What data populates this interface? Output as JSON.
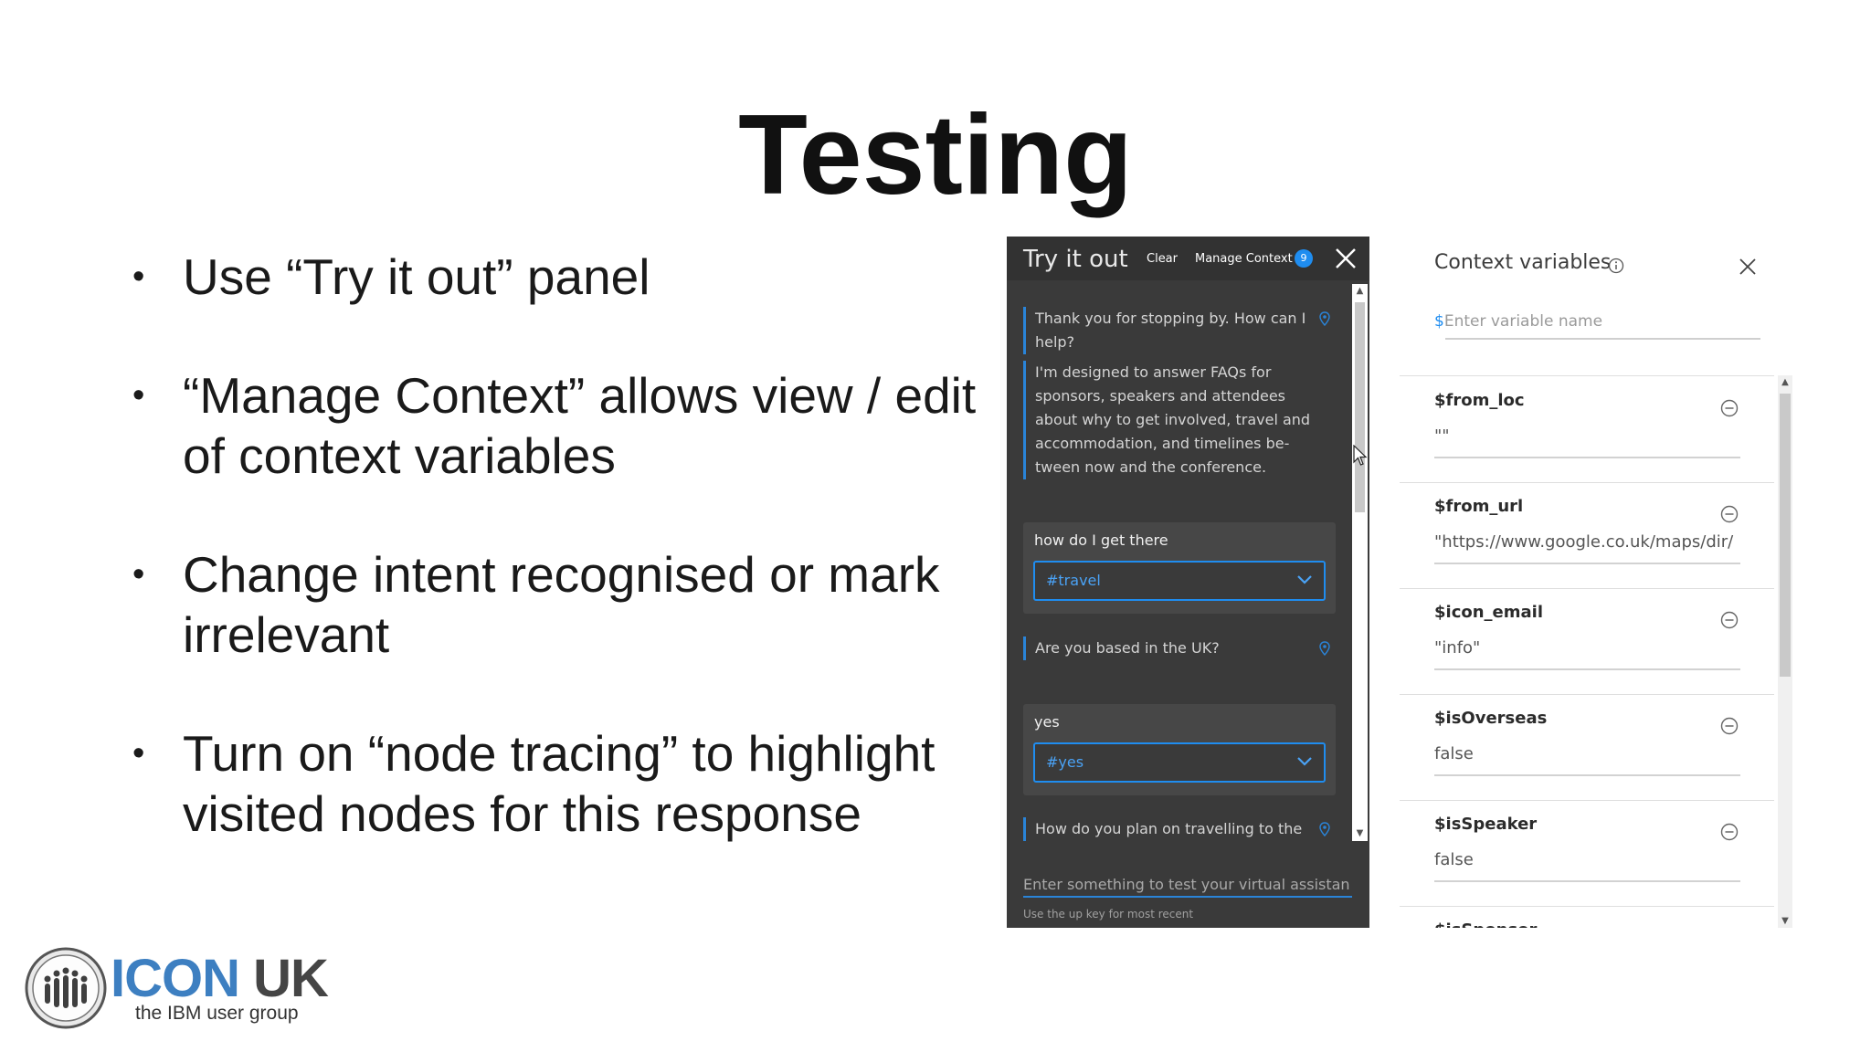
{
  "slide": {
    "title": "Testing",
    "bullets": [
      {
        "line1": "Use “Try it out” panel",
        "line2": ""
      },
      {
        "line1": "“Manage Context” allows view / edit",
        "line2": "of context variables"
      },
      {
        "line1": "Change intent recognised or mark",
        "line2": "irrelevant"
      },
      {
        "line1": "Turn on “node tracing” to highlight",
        "line2": "visited nodes for this response"
      }
    ],
    "bullet_char": "•"
  },
  "try_it_out": {
    "title": "Try it out",
    "clear_label": "Clear",
    "manage_context_label": "Manage Context",
    "context_count": "9",
    "messages": [
      "Thank you for stopping by. How can I help?",
      "I'm designed to answer FAQs for sponsors, speakers and attendees about why to get involved, travel and accommodation, and timelines be-tween now and the conference."
    ],
    "user_inputs": [
      {
        "text": "how do I get there",
        "intent": "#travel"
      },
      {
        "text": "yes",
        "intent": "#yes"
      }
    ],
    "reply_uk": "Are you based in the UK?",
    "reply_travel": "How do you plan on travelling to the",
    "input_placeholder": "Enter something to test your virtual assistan",
    "input_hint": "Use the up key for most recent"
  },
  "context_variables": {
    "title": "Context variables",
    "new_var_prefix": "$",
    "new_var_placeholder": "Enter variable name",
    "variables": [
      {
        "name": "$from_loc",
        "value": "\"\""
      },
      {
        "name": "$from_url",
        "value": "\"https://www.google.co.uk/maps/dir/"
      },
      {
        "name": "$icon_email",
        "value": "\"info\""
      },
      {
        "name": "$isOverseas",
        "value": "false"
      },
      {
        "name": "$isSpeaker",
        "value": "false"
      },
      {
        "name": "$isSponsor",
        "value": ""
      }
    ]
  },
  "logo": {
    "name_part1": "ICON",
    "name_part2": " UK",
    "tagline": "the IBM user group"
  },
  "colors": {
    "accent_blue": "#1f8df0",
    "panel_dark": "#3a3a3a",
    "logo_blue": "#3d7fc1"
  }
}
